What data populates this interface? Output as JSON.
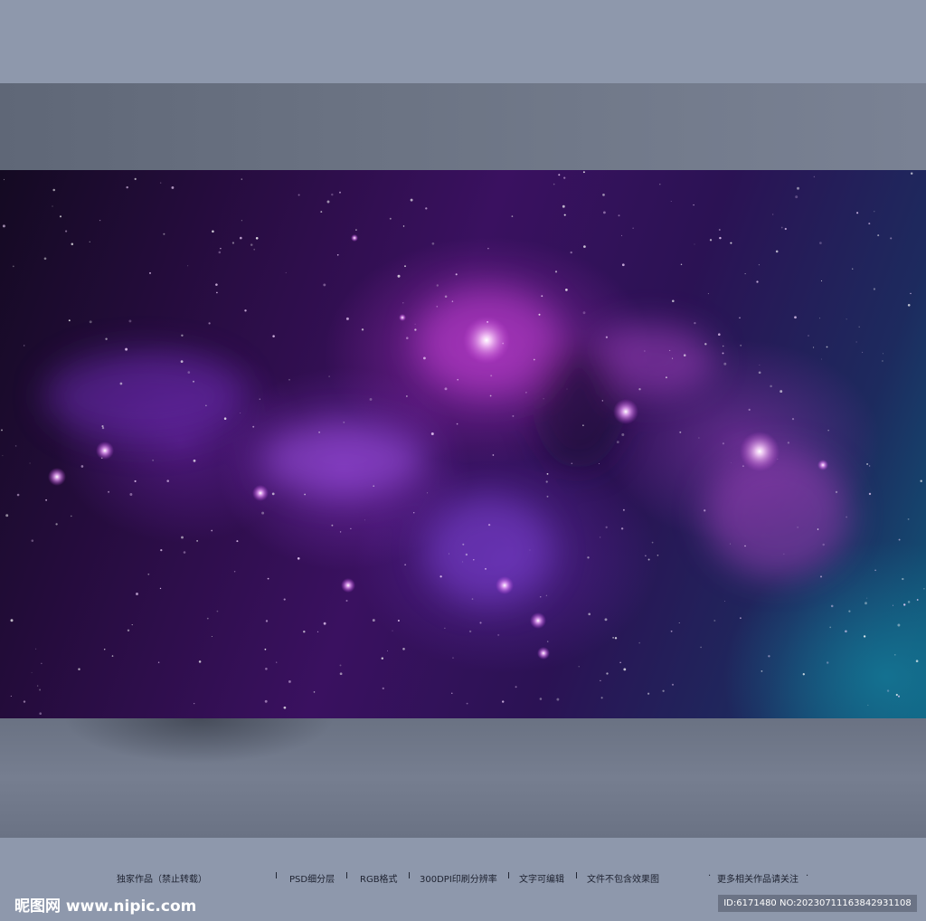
{
  "footer": {
    "items": [
      "独家作品（禁止转载）",
      "PSD细分层",
      "RGB格式",
      "300DPI印刷分辨率",
      "文字可编辑",
      "文件不包含效果图",
      "更多相关作品请关注"
    ],
    "separator": "I",
    "dot": "·"
  },
  "watermark": {
    "logo_text": "昵图网 www.nipic.com",
    "id_text": "ID:6171480 NO:20230711163842931108"
  },
  "colors": {
    "frame": "#8e98ac",
    "band": "#6b7383",
    "nebula_purple": "#3a1160",
    "nebula_teal": "#0f5a7a"
  }
}
